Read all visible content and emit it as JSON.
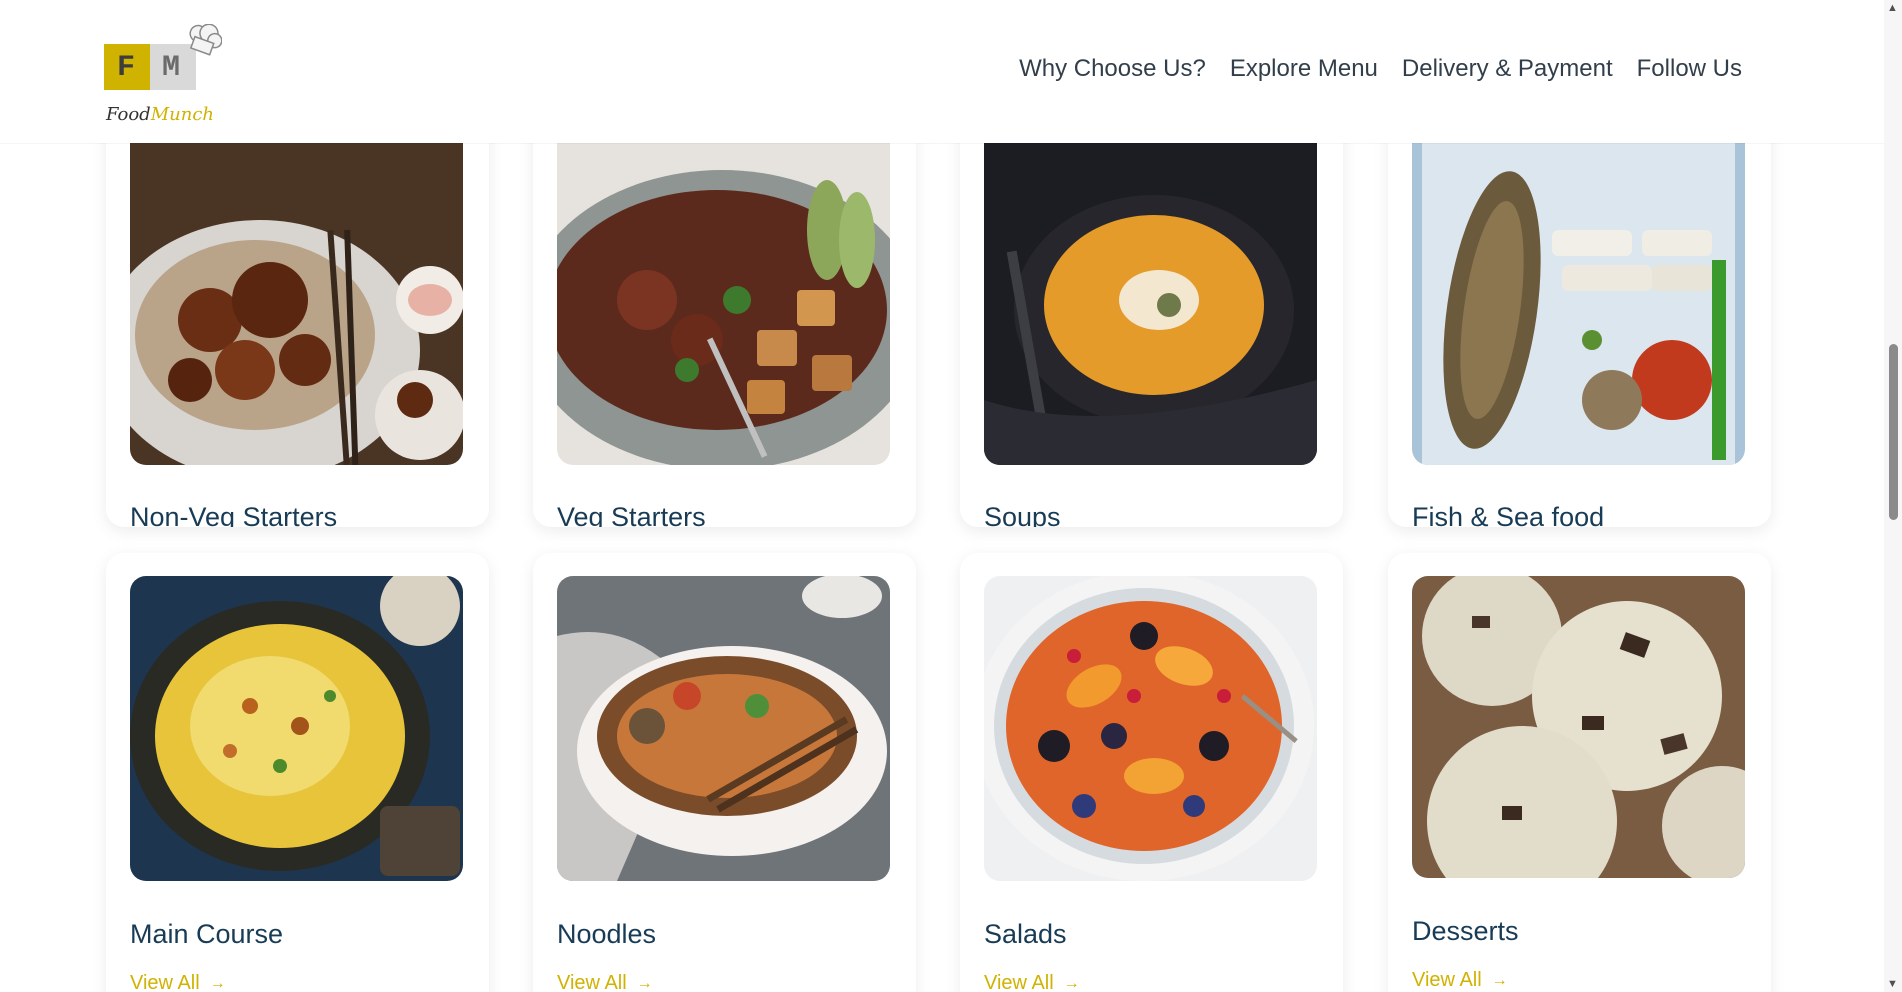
{
  "brand": {
    "logo_left": "F",
    "logo_right": "M",
    "name_part1": "Food",
    "name_part2": "Munch"
  },
  "nav": {
    "items": [
      "Why Choose Us?",
      "Explore Menu",
      "Delivery & Payment",
      "Follow Us"
    ]
  },
  "menu": {
    "link_label": "View All",
    "arrow": "→",
    "categories": [
      {
        "title": "Non-Veg Starters",
        "image": "fried-chicken-photo"
      },
      {
        "title": "Veg Starters",
        "image": "tofu-bowl-photo"
      },
      {
        "title": "Soups",
        "image": "pumpkin-soup-photo"
      },
      {
        "title": "Fish & Sea food",
        "image": "seafood-platter-photo"
      },
      {
        "title": "Main Course",
        "image": "biryani-photo"
      },
      {
        "title": "Noodles",
        "image": "noodles-bowl-photo"
      },
      {
        "title": "Salads",
        "image": "fruit-salad-photo"
      },
      {
        "title": "Desserts",
        "image": "ice-cream-photo"
      }
    ]
  },
  "colors": {
    "accent": "#d0b200",
    "heading": "#183b56",
    "nav_text": "#323f4b"
  },
  "scrollbar": {
    "up_icon": "▲",
    "down_icon": "▼"
  }
}
